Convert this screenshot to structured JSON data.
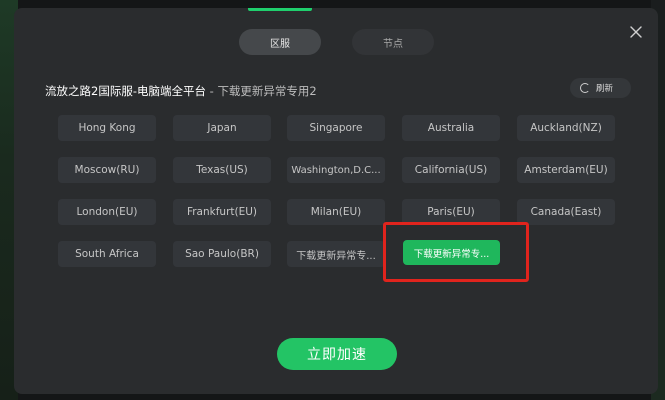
{
  "tabs": {
    "region": "区服",
    "node": "节点"
  },
  "title": {
    "game": "流放之路2国际服-电脑端全平台",
    "separator": " - ",
    "mode": "下载更新异常专用2"
  },
  "refresh_label": "刷新",
  "regions": [
    [
      "Hong Kong",
      "Japan",
      "Singapore",
      "Australia",
      "Auckland(NZ)"
    ],
    [
      "Moscow(RU)",
      "Texas(US)",
      "Washington,D.C...",
      "California(US)",
      "Amsterdam(EU)"
    ],
    [
      "London(EU)",
      "Frankfurt(EU)",
      "Milan(EU)",
      "Paris(EU)",
      "Canada(East)"
    ],
    [
      "South Africa",
      "Sao Paulo(BR)",
      "下载更新异常专..."
    ]
  ],
  "selected_region": "下载更新异常专...",
  "accelerate_label": "立即加速",
  "colors": {
    "accent": "#1fcf6d",
    "highlight_border": "#e0241d",
    "selected_bg": "#1fb75c"
  }
}
